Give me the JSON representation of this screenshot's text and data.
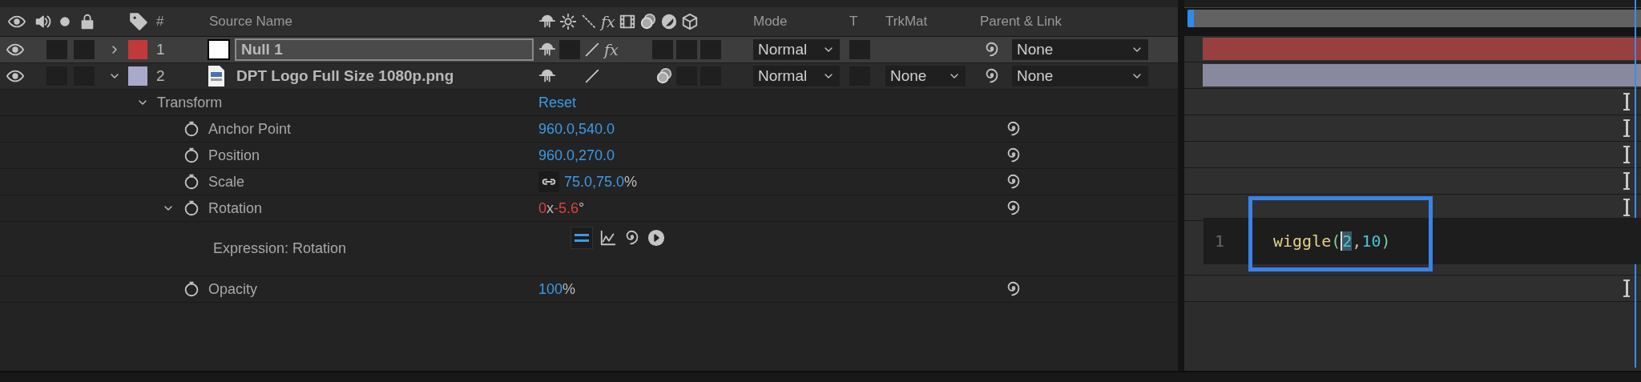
{
  "header": {
    "number": "#",
    "source_name": "Source Name",
    "fx": "fx",
    "mode": "Mode",
    "t": "T",
    "trkmat": "TrkMat",
    "parent": "Parent & Link"
  },
  "layers": [
    {
      "number": "1",
      "name": "Null 1",
      "kind": "null",
      "color": "#c2393b",
      "selected": true,
      "expanded": false,
      "fx": "fx",
      "motion_blur": false,
      "mode": "Normal",
      "parent": "None"
    },
    {
      "number": "2",
      "name": "DPT Logo Full Size 1080p.png",
      "kind": "image",
      "color": "#a9aacb",
      "selected": false,
      "expanded": true,
      "motion_blur": true,
      "mode": "Normal",
      "trkmat": "None",
      "parent": "None"
    }
  ],
  "transform": {
    "label": "Transform",
    "reset": "Reset",
    "expanded": true
  },
  "properties": [
    {
      "name": "Anchor Point",
      "kind": "plain",
      "has_expression": false,
      "segments": [
        {
          "text": "960.0,540.0",
          "kind": "number"
        }
      ]
    },
    {
      "name": "Position",
      "kind": "plain",
      "has_expression": false,
      "segments": [
        {
          "text": "960.0,270.0",
          "kind": "number"
        }
      ]
    },
    {
      "name": "Scale",
      "kind": "linked",
      "has_expression": false,
      "segments": [
        {
          "text": "75.0,75.0",
          "kind": "number"
        },
        {
          "text": "%",
          "kind": "unit"
        }
      ]
    },
    {
      "name": "Rotation",
      "kind": "plain",
      "has_expression": true,
      "expanded": true,
      "segments": [
        {
          "text": "0",
          "kind": "number"
        },
        {
          "text": "x",
          "kind": "unit"
        },
        {
          "text": "-5.6",
          "kind": "number"
        },
        {
          "text": "°",
          "kind": "unit"
        }
      ],
      "expression": {
        "label": "Expression: Rotation",
        "line": "1",
        "tokens": [
          {
            "text": "wiggle",
            "kind": "func"
          },
          {
            "text": "(",
            "kind": "paren"
          },
          {
            "text": "2",
            "kind": "number",
            "selected": true
          },
          {
            "text": ",",
            "kind": "punct"
          },
          {
            "text": "10",
            "kind": "number"
          },
          {
            "text": ")",
            "kind": "paren"
          }
        ]
      }
    },
    {
      "name": "Opacity",
      "kind": "plain",
      "has_expression": false,
      "segments": [
        {
          "text": "100",
          "kind": "number"
        },
        {
          "text": "%",
          "kind": "unit"
        }
      ]
    }
  ]
}
